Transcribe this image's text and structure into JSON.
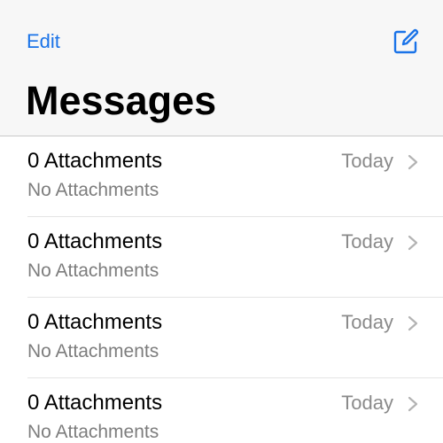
{
  "header": {
    "edit_label": "Edit",
    "compose_icon": "compose-icon",
    "title": "Messages"
  },
  "colors": {
    "accent": "#1a73e8",
    "secondary_text": "#7d7d7d",
    "header_bg": "#f7f7f7"
  },
  "conversations": [
    {
      "title": "0 Attachments",
      "subtitle": "No Attachments",
      "date": "Today"
    },
    {
      "title": "0 Attachments",
      "subtitle": "No Attachments",
      "date": "Today"
    },
    {
      "title": "0 Attachments",
      "subtitle": "No Attachments",
      "date": "Today"
    },
    {
      "title": "0 Attachments",
      "subtitle": "No Attachments",
      "date": "Today"
    }
  ]
}
